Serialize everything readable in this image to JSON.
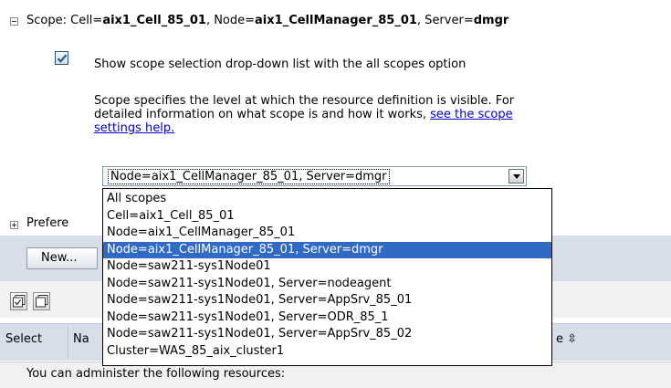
{
  "scope": {
    "label": "Scope: Cell=",
    "cell": "aix1_Cell_85_01",
    "node_label": ", Node=",
    "node": "aix1_CellManager_85_01",
    "server_label": ", Server=",
    "server": "dmgr"
  },
  "show_all_scopes": {
    "checked": true,
    "label": "Show scope selection drop-down list with the all scopes option"
  },
  "description": {
    "line1": "Scope specifies the level at which the resource definition is visible. For",
    "line2": "detailed information on what scope is and how it works, ",
    "link_a": "see the scope",
    "link_b": "settings help."
  },
  "scope_select": {
    "selected": "Node=aix1_CellManager_85_01, Server=dmgr",
    "options": [
      "All scopes",
      "Cell=aix1_Cell_85_01",
      "Node=aix1_CellManager_85_01",
      "Node=aix1_CellManager_85_01, Server=dmgr",
      "Node=saw211-sys1Node01",
      "Node=saw211-sys1Node01, Server=nodeagent",
      "Node=saw211-sys1Node01, Server=AppSrv_85_01",
      "Node=saw211-sys1Node01, Server=ODR_85_1",
      "Node=saw211-sys1Node01, Server=AppSrv_85_02",
      "Cluster=WAS_85_aix_cluster1"
    ]
  },
  "preferences": {
    "label": "Prefere"
  },
  "toolbar": {
    "new_label": "New..."
  },
  "table": {
    "col_select": "Select",
    "col_name": "Na",
    "col_scope": "e ⇳"
  },
  "resources_msg": "You can administer the following resources:",
  "colors": {
    "selection": "#316ac5",
    "link": "#0000cc",
    "band": "#d6dfe9"
  }
}
